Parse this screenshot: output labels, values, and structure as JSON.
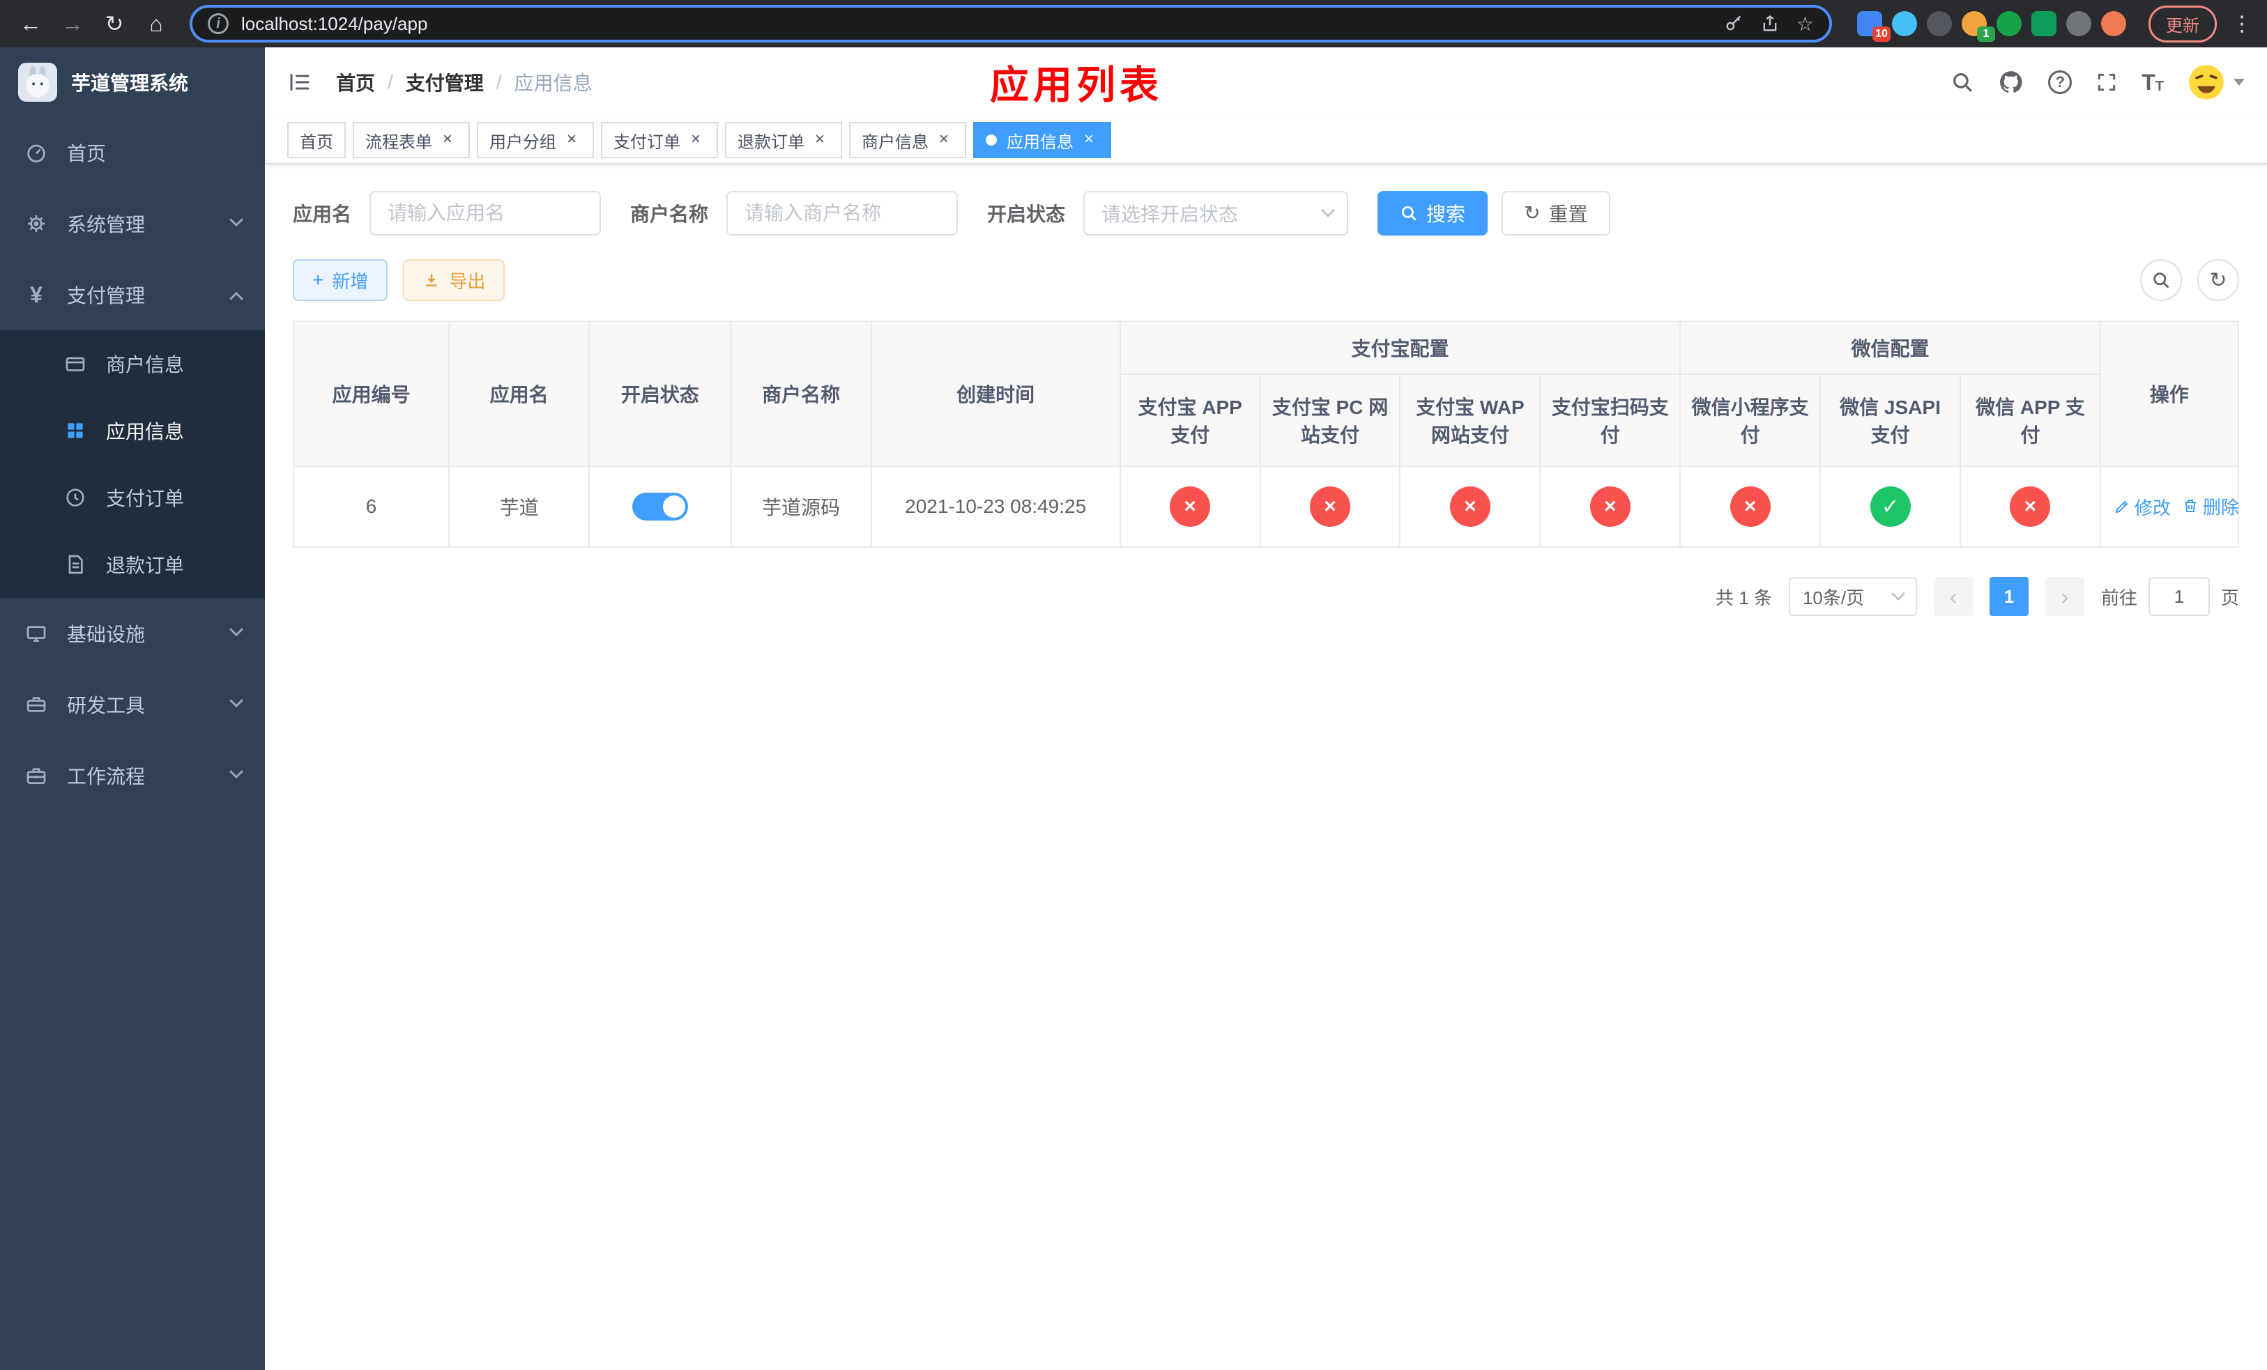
{
  "colors": {
    "primary": "#409eff",
    "success": "#1ec468",
    "danger": "#f9514e",
    "warning": "#e6a23c",
    "title_red": "#ff0000",
    "sidebar_bg": "#304156",
    "submenu_bg": "#1f2d3d"
  },
  "icons": {
    "back": "←",
    "forward": "→",
    "reload": "↻",
    "home": "⌂",
    "info": "i",
    "star": "☆",
    "kebab": "⋮",
    "help": "?",
    "font_large": "T",
    "font_small": "T",
    "close": "×",
    "check": "✓",
    "cross": "×",
    "plus": "+",
    "refresh": "↻",
    "yen": "¥",
    "prev": "‹",
    "next": "›"
  },
  "browser": {
    "url": "localhost:1024/pay/app",
    "update_button": "更新",
    "extensions": [
      {
        "name": "extension-blue-pin",
        "color": "#4285f4",
        "badge": "10",
        "badge_color": "#e94235",
        "shape": "square"
      },
      {
        "name": "extension-blue-diamond",
        "color": "#45c0f5",
        "shape": "circle"
      },
      {
        "name": "extension-dark-circle",
        "color": "#54575d",
        "shape": "circle"
      },
      {
        "name": "extension-colorful",
        "color": "#f2a33c",
        "badge": "1",
        "badge_color": "#2fa44f",
        "shape": "circle"
      },
      {
        "name": "extension-green-check",
        "color": "#17a34a",
        "shape": "circle"
      },
      {
        "name": "extension-green-chat",
        "color": "#0c9d58",
        "shape": "square"
      },
      {
        "name": "extension-gray-pin",
        "color": "#70757c",
        "shape": "circle"
      },
      {
        "name": "extension-orange-face",
        "color": "#ee7a52",
        "shape": "circle"
      }
    ]
  },
  "sidebar": {
    "title": "芋道管理系统",
    "home": "首页",
    "system": "系统管理",
    "payment": "支付管理",
    "payment_children": [
      "商户信息",
      "应用信息",
      "支付订单",
      "退款订单"
    ],
    "infrastructure": "基础设施",
    "devtools": "研发工具",
    "workflow": "工作流程"
  },
  "header": {
    "breadcrumb": [
      "首页",
      "支付管理",
      "应用信息"
    ],
    "separator": "/",
    "page_title": "应用列表"
  },
  "tabs": [
    "首页",
    "流程表单",
    "用户分组",
    "支付订单",
    "退款订单",
    "商户信息",
    "应用信息"
  ],
  "filters": {
    "app_name_label": "应用名",
    "app_name_placeholder": "请输入应用名",
    "merchant_label": "商户名称",
    "merchant_placeholder": "请输入商户名称",
    "status_label": "开启状态",
    "status_placeholder": "请选择开启状态",
    "search_button": "搜索",
    "reset_button": "重置"
  },
  "toolbar": {
    "add_button": "新增",
    "export_button": "导出"
  },
  "table": {
    "group_alipay": "支付宝配置",
    "group_wechat": "微信配置",
    "columns": [
      "应用编号",
      "应用名",
      "开启状态",
      "商户名称",
      "创建时间",
      "支付宝 APP 支付",
      "支付宝 PC 网站支付",
      "支付宝 WAP 网站支付",
      "支付宝扫码支付",
      "微信小程序支付",
      "微信 JSAPI 支付",
      "微信 APP 支付",
      "操作"
    ],
    "rows": [
      {
        "id": "6",
        "name": "芋道",
        "enabled": true,
        "merchant": "芋道源码",
        "created_at": "2021-10-23 08:49:25",
        "pay_status": {
          "alipay_app": false,
          "alipay_pc": false,
          "alipay_wap": false,
          "alipay_qr": false,
          "wechat_lite": false,
          "wechat_jsapi": true,
          "wechat_app": false
        },
        "actions": {
          "edit": "修改",
          "delete": "删除"
        }
      }
    ]
  },
  "pagination": {
    "total": "共 1 条",
    "page_size": "10条/页",
    "page": "1",
    "goto_label": "前往",
    "goto_value": "1",
    "goto_unit": "页"
  }
}
